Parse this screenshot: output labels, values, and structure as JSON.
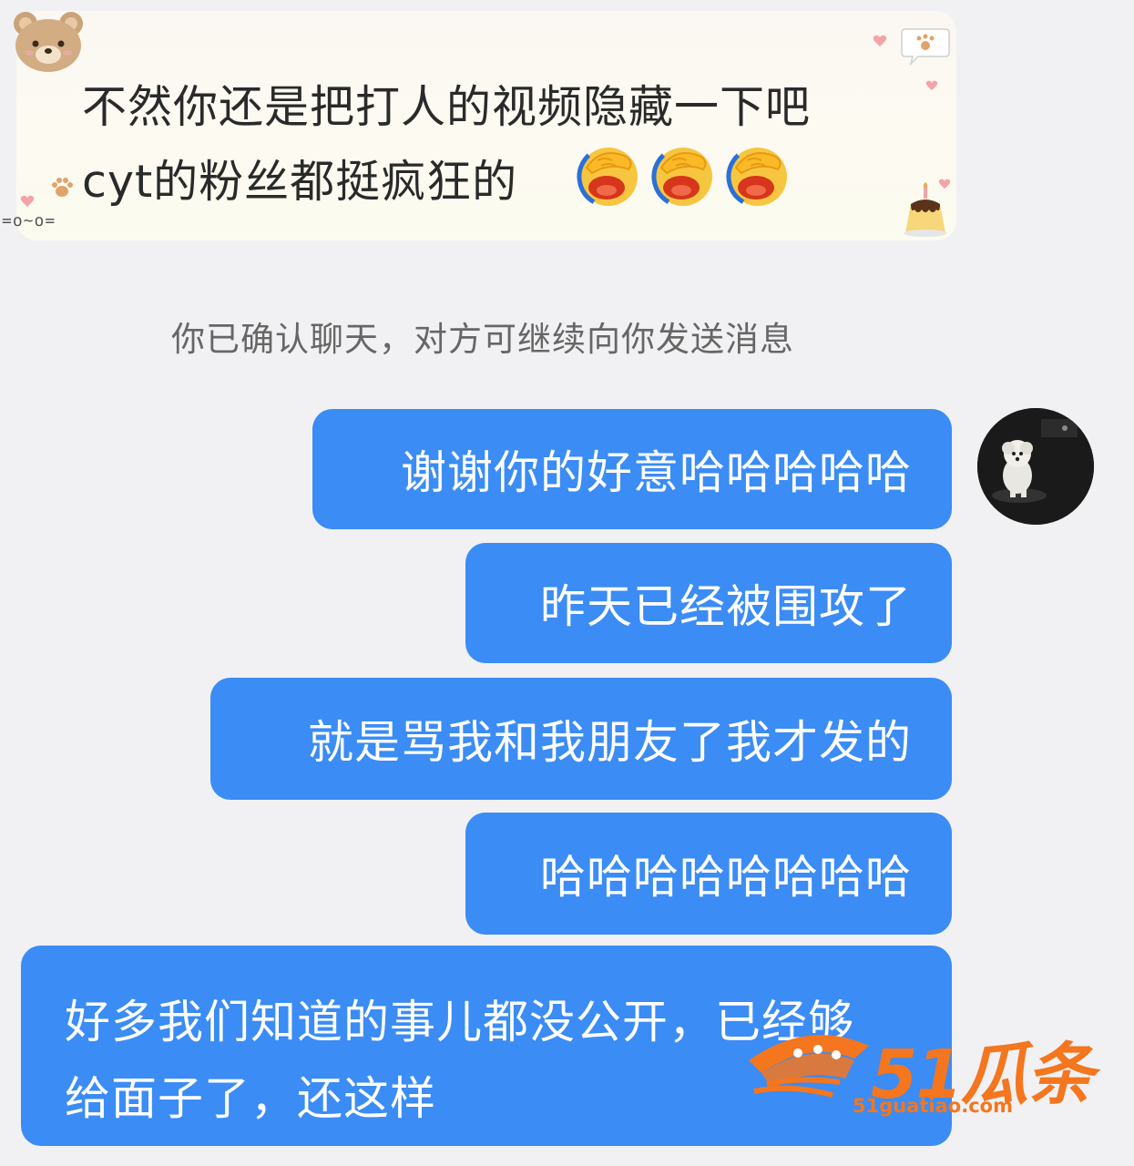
{
  "incoming_message": {
    "line1": "不然你还是把打人的视频隐藏一下吧",
    "line2": "cyt的粉丝都挺疯狂的",
    "emojis": [
      "facepalm-cry-emoji",
      "facepalm-cry-emoji",
      "facepalm-cry-emoji"
    ],
    "kaomoji": "=o~o="
  },
  "system_notice": "你已确认聊天，对方可继续向你发送消息",
  "outgoing_messages": [
    "谢谢你的好意哈哈哈哈哈",
    "昨天已经被围攻了",
    "就是骂我和我朋友了我才发的",
    "哈哈哈哈哈哈哈哈"
  ],
  "outgoing_long": {
    "line1": "好多我们知道的事儿都没公开，已经够",
    "line2": "给面子了，还这样"
  },
  "watermark": {
    "brand": "51瓜条",
    "url": "51guatiao.com"
  },
  "colors": {
    "outgoing_bubble": "#3b8cf5",
    "background": "#f1f1f3",
    "watermark": "#f4761e"
  }
}
